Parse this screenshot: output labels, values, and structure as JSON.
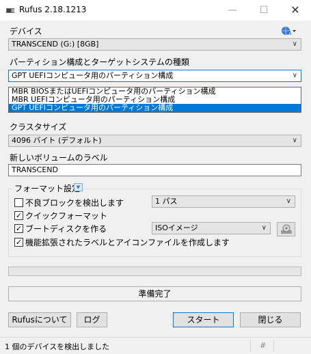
{
  "window": {
    "title": "Rufus 2.18.1213"
  },
  "device": {
    "label": "デバイス",
    "value": "TRANSCEND (G:) [8GB]"
  },
  "partition": {
    "label": "パーティション構成とターゲットシステムの種類",
    "value": "GPT UEFIコンピュータ用のパーティション構成",
    "options": [
      "MBR BIOSまたはUEFIコンピュータ用のパーティション構成",
      "MBR UEFIコンピュータ用のパーティション構成",
      "GPT UEFIコンピュータ用のパーティション構成"
    ]
  },
  "cluster": {
    "label": "クラスタサイズ",
    "value": "4096 バイト (デフォルト)"
  },
  "volume": {
    "label": "新しいボリュームのラベル",
    "value": "TRANSCEND"
  },
  "format": {
    "title": "フォーマット設定",
    "bad_blocks": {
      "label": "不良ブロックを検出します",
      "checked": false,
      "passes": "1 パス"
    },
    "quick_format": {
      "label": "クイックフォーマット",
      "checked": true
    },
    "bootable": {
      "label": "ブートディスクを作る",
      "checked": true,
      "type": "ISOイメージ"
    },
    "extended_label": {
      "label": "機能拡張されたラベルとアイコンファイルを作成します",
      "checked": true
    }
  },
  "progress": {
    "value": 0
  },
  "status": {
    "ready": "準備完了"
  },
  "buttons": {
    "about": "Rufusについて",
    "log": "ログ",
    "start": "スタート",
    "close": "閉じる"
  },
  "statusbar": {
    "text": "1 個のデバイスを検出しました",
    "hash": "#"
  },
  "icons": {
    "window_close": "✕",
    "window_minimize": "—",
    "window_maximize": "☐"
  }
}
